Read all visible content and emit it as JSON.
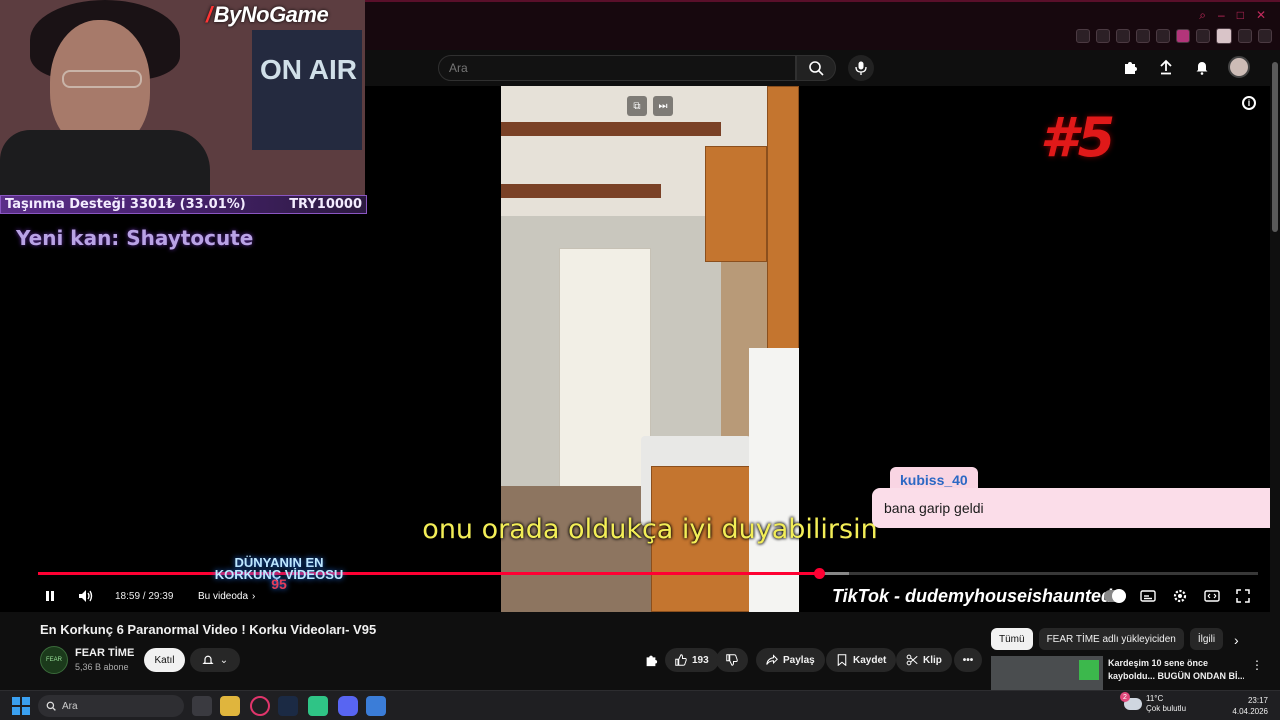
{
  "browser": {
    "window_controls": [
      "–",
      "□",
      "✕"
    ],
    "extensions": [
      "pin-icon",
      "bookmark-icon",
      "shield-icon",
      "play-icon",
      "heart-icon",
      "extension-icon",
      "puzzle-icon",
      "profile-icon",
      "download-icon",
      "menu-icon"
    ]
  },
  "youtube_header": {
    "search_placeholder": "Ara"
  },
  "streamer_overlay": {
    "brand": "ByNoGame",
    "poster_text": "ON AIR",
    "donation_label": "Taşınma Desteği 3301₺ (33.01%)",
    "donation_goal": "TRY10000",
    "donation_progress_fraction": 0.3301,
    "new_subscriber": "Yeni kan: Shaytocute"
  },
  "player": {
    "episode_number": "#5",
    "subtitle": "onu orada oldukça iyi duyabilirsin",
    "chat": {
      "username": "kubiss_40",
      "message": "bana garip geldi"
    },
    "time_current": "18:59",
    "time_total": "29:39",
    "time_display": "18:59 / 29:39",
    "played_fraction": 0.64,
    "chapter_label": "Bu videoda",
    "overlay_title_line1": "DÜNYANIN EN",
    "overlay_title_line2": "KORKUNÇ VİDEOSU",
    "overlay_title_number": "95",
    "tiktok_credit": "TikTok - dudemyhouseishaunted"
  },
  "video_info": {
    "title": "En Korkunç 6 Paranormal Video ! Korku Videoları- V95",
    "channel_name": "FEAR TİME",
    "channel_avatar_text": "FEAR",
    "subscribers": "5,36 B abone",
    "join_label": "Katıl",
    "likes": "193",
    "share_label": "Paylaş",
    "save_label": "Kaydet",
    "clip_label": "Klip"
  },
  "sidebar": {
    "chips": [
      "Tümü",
      "FEAR TİME adlı yükleyiciden",
      "İlgili"
    ],
    "recommendation": {
      "title_line1": "Kardeşim 10 sene önce",
      "title_line2": "kayboldu... BUGÜN ONDAN Bİ..."
    }
  },
  "taskbar": {
    "search_label": "Ara",
    "weather_temp": "11°C",
    "weather_desc": "Çok bulutlu",
    "notification_count": "2",
    "time": "23:17",
    "date": "4.04.2026"
  }
}
